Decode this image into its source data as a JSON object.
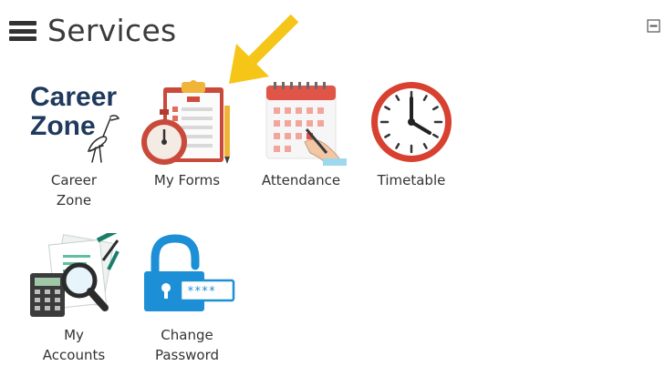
{
  "header": {
    "title": "Services"
  },
  "tiles": [
    {
      "id": "career-zone",
      "label_lines": [
        "Career",
        "Zone"
      ],
      "logo_lines": [
        "Career",
        "Zone"
      ]
    },
    {
      "id": "my-forms",
      "label_lines": [
        "My Forms"
      ]
    },
    {
      "id": "attendance",
      "label_lines": [
        "Attendance"
      ]
    },
    {
      "id": "timetable",
      "label_lines": [
        "Timetable"
      ]
    },
    {
      "id": "my-accounts",
      "label_lines": [
        "My",
        "Accounts"
      ]
    },
    {
      "id": "change-password",
      "label_lines": [
        "Change",
        "Password"
      ],
      "mask_text": "****"
    }
  ],
  "icons": {
    "menu": "hamburger-menu-icon",
    "collapse": "minimize-panel-icon",
    "annotation": "yellow-pointer-arrow",
    "career_zone": "career-zone-heron-logo",
    "my_forms": "clipboard-stopwatch-icon",
    "attendance": "calendar-pen-icon",
    "timetable": "wall-clock-icon",
    "my_accounts": "calculator-magnifier-icon",
    "change_password": "padlock-password-icon"
  },
  "colors": {
    "accent_arrow": "#f5c518",
    "clock_red": "#d8402f",
    "lock_blue": "#1d8fd6",
    "title_text": "#3b3b3b"
  }
}
